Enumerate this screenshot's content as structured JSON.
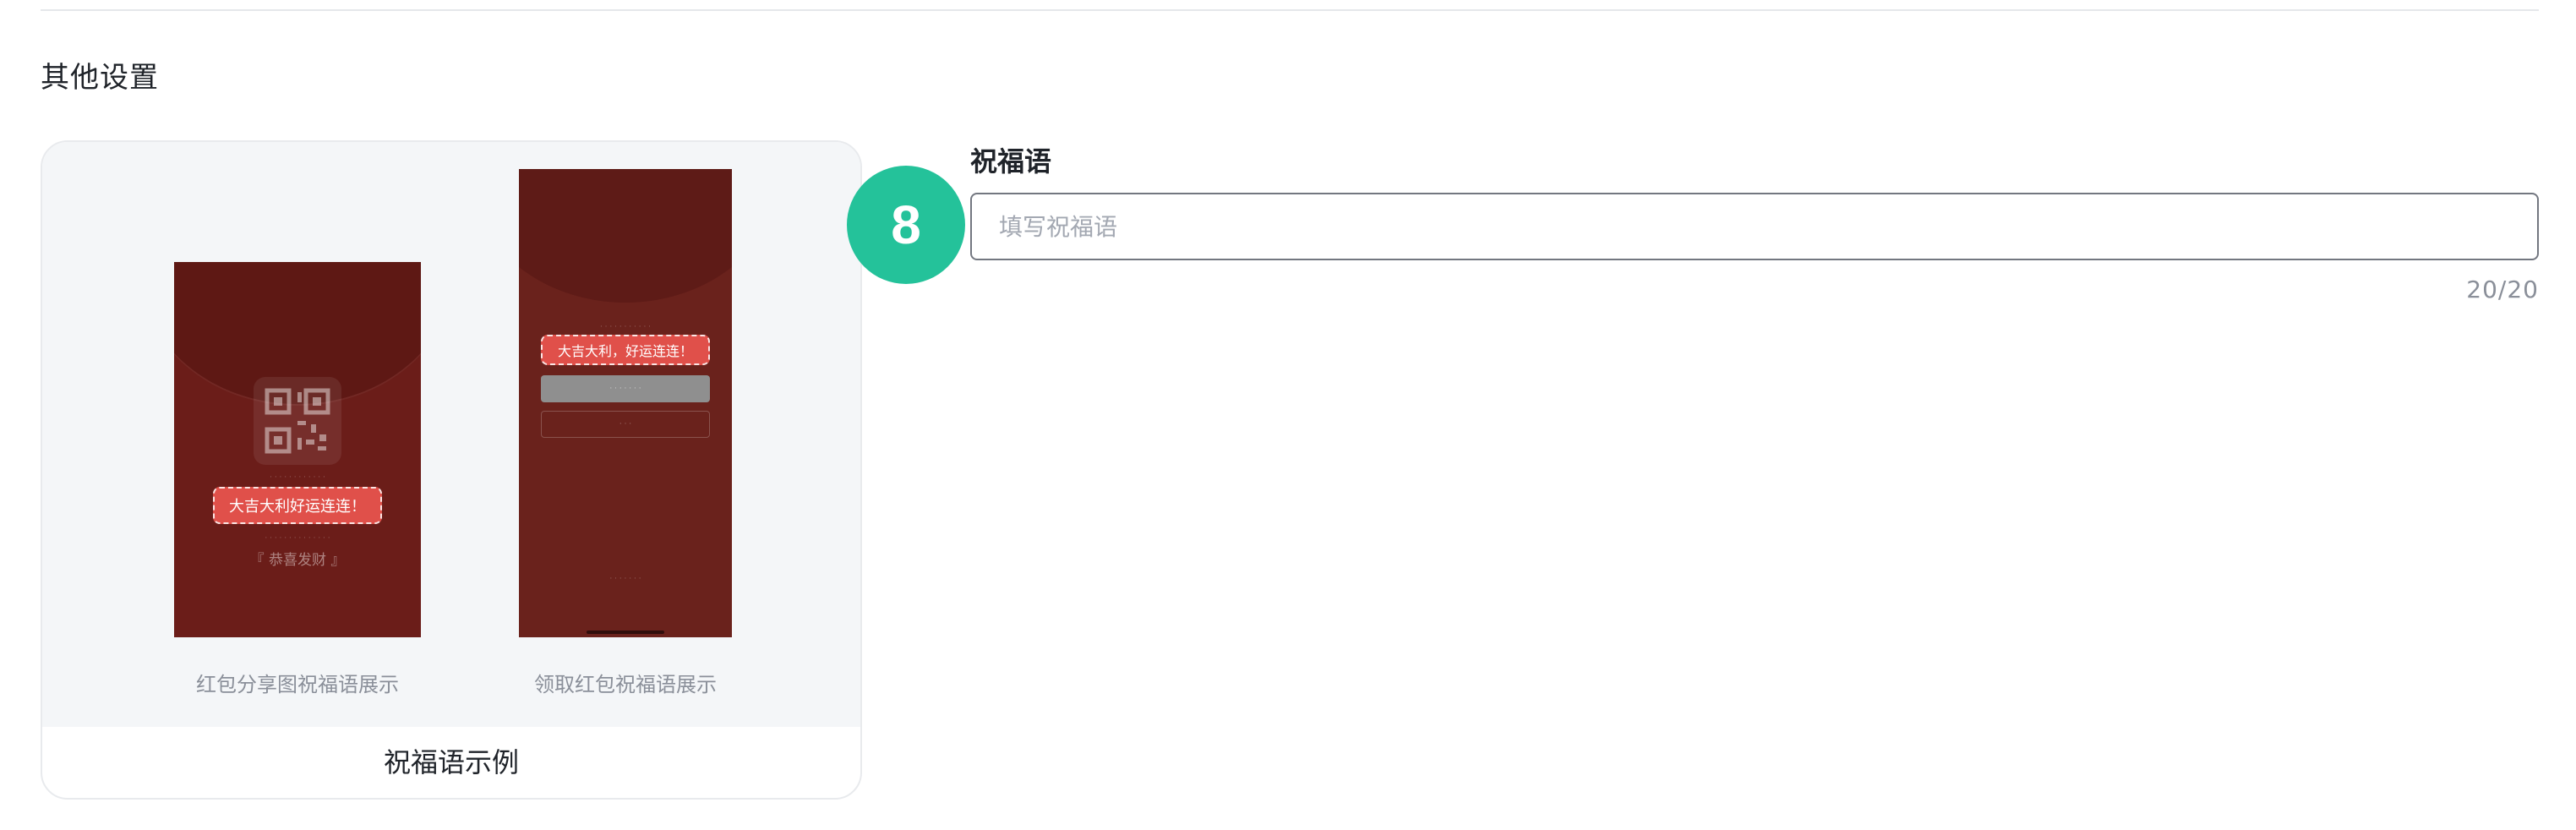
{
  "section": {
    "title": "其他设置"
  },
  "preview": {
    "card_footer_label": "祝福语示例",
    "share_image": {
      "caption": "红包分享图祝福语展示",
      "banner_text": "大吉大利好运连连！",
      "signature_text": "『 恭喜发财 』"
    },
    "receive_page": {
      "caption": "领取红包祝福语展示",
      "banner_text": "大吉大利，好运连连！"
    }
  },
  "form": {
    "step_number": "8",
    "blessing_field": {
      "label": "祝福语",
      "value": "",
      "placeholder": "填写祝福语",
      "counter": "20/20"
    }
  },
  "colors": {
    "accent": "#24c29a",
    "envelope_red": "#6b1d19",
    "banner_red": "#e0504a"
  }
}
